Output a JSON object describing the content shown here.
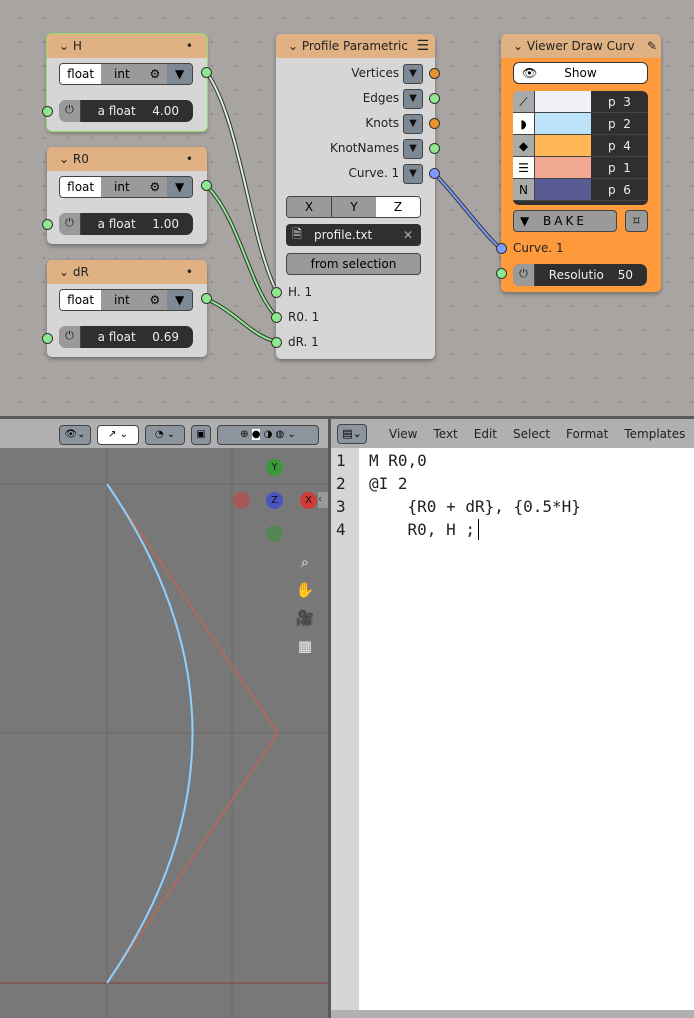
{
  "nodes": {
    "h": {
      "title": "H",
      "mode_float": "float",
      "mode_int": "int",
      "field_label": "a float",
      "value": "4.00"
    },
    "r0": {
      "title": "R0",
      "mode_float": "float",
      "mode_int": "int",
      "field_label": "a float",
      "value": "1.00"
    },
    "dr": {
      "title": "dR",
      "mode_float": "float",
      "mode_int": "int",
      "field_label": "a float",
      "value": "0.69"
    },
    "profile": {
      "title": "Profile Parametric",
      "outputs": [
        "Vertices",
        "Edges",
        "Knots",
        "KnotNames",
        "Curve. 1"
      ],
      "axes": [
        "X",
        "Y",
        "Z"
      ],
      "selected_axis": "Z",
      "file": "profile.txt",
      "from_selection": "from selection",
      "inputs": [
        "H. 1",
        "R0. 1",
        "dR. 1"
      ]
    },
    "viewer": {
      "title": "Viewer Draw Curv",
      "show": "Show",
      "rows": [
        {
          "label": "p  3",
          "color": "#f0f0f7"
        },
        {
          "label": "p  2",
          "color": "#bde3fb"
        },
        {
          "label": "p  4",
          "color": "#ffb655"
        },
        {
          "label": "p  1",
          "color": "#f0a892"
        },
        {
          "label": "p  6",
          "color": "#585a94"
        }
      ],
      "bake": "BAKE",
      "input": "Curve. 1",
      "res_label": "Resolutio",
      "res_value": "50",
      "node_color": "#ff9a3c"
    }
  },
  "text_editor": {
    "menus": [
      "View",
      "Text",
      "Edit",
      "Select",
      "Format",
      "Templates"
    ],
    "lines": [
      "M R0,0",
      "@I 2",
      "    {R0 + dR}, {0.5*H}",
      "    R0, H ;"
    ]
  },
  "gizmo": {
    "y": "Y",
    "z": "Z",
    "x": "X"
  }
}
